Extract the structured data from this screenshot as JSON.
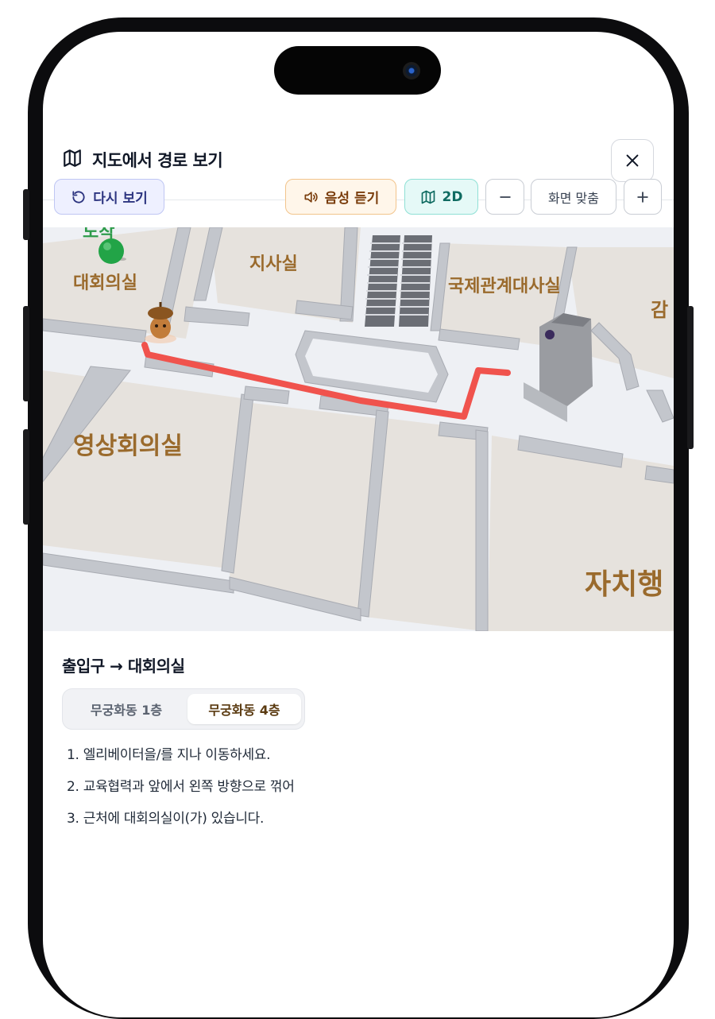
{
  "header": {
    "title": "지도에서 경로 보기"
  },
  "toolbar": {
    "replay_label": "다시 보기",
    "voice_label": "음성 듣기",
    "mode_label": "2D",
    "zoom_out_label": "−",
    "fit_label": "화면 맞춤",
    "zoom_in_label": "+"
  },
  "map": {
    "labels": {
      "top_partial": "도착",
      "conference_room": "대회의실",
      "branch_office": "지사실",
      "intl_conference_room": "국제관계대사실",
      "partial_right": "감",
      "video_conference_room": "영상회의실",
      "autonomous_admin": "자치행"
    },
    "route_color": "#f0534d",
    "destination_pin_color": "#22a447"
  },
  "route": {
    "title": "출입구 → 대회의실",
    "floor_tabs": [
      {
        "label": "무궁화동 1층",
        "active": false
      },
      {
        "label": "무궁화동 4층",
        "active": true
      }
    ],
    "steps": [
      "1. 엘리베이터을/를 지나 이동하세요.",
      "2. 교육협력과 앞에서 왼쪽 방향으로 꺾어",
      "3. 근처에 대회의실이(가) 있습니다."
    ]
  }
}
